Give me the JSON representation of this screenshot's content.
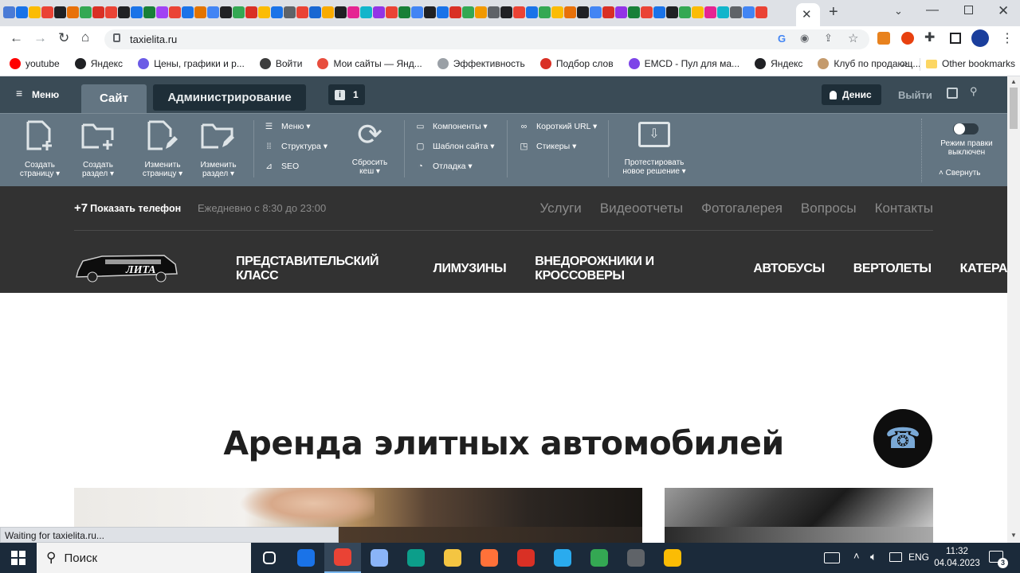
{
  "browser": {
    "url": "taxielita.ru",
    "tab_colors": [
      "#4a7bd6",
      "#1a73e8",
      "#fbbc04",
      "#ea4335",
      "#202124",
      "#e8710a",
      "#34a853",
      "#d93025",
      "#ea4335",
      "#202124",
      "#1a73e8",
      "#188038",
      "#a142f4",
      "#ea4335",
      "#1a73e8",
      "#e37400",
      "#4285f4",
      "#202124",
      "#34a853",
      "#d93025",
      "#fbbc04",
      "#1a73e8",
      "#5f6368",
      "#ea4335",
      "#1967d2",
      "#f9ab00",
      "#202124",
      "#e52592",
      "#12b5cb",
      "#9334e6",
      "#ea4335",
      "#188038",
      "#4285f4",
      "#202124",
      "#1a73e8",
      "#d93025",
      "#34a853",
      "#f29900",
      "#5f6368",
      "#202124",
      "#ea4335",
      "#1a73e8",
      "#34a853",
      "#fbbc04",
      "#e8710a",
      "#202124",
      "#4285f4",
      "#d93025",
      "#9334e6",
      "#188038",
      "#ea4335",
      "#1a73e8",
      "#202124",
      "#34a853",
      "#fbbc04",
      "#e52592",
      "#12b5cb",
      "#5f6368",
      "#4285f4",
      "#ea4335"
    ],
    "bookmarks": [
      {
        "label": "youtube",
        "color": "#ff0000"
      },
      {
        "label": "Яндекс",
        "color": "#202124"
      },
      {
        "label": "Цены, графики и р...",
        "color": "#6b5be6"
      },
      {
        "label": "Войти",
        "color": "#3c3c3c"
      },
      {
        "label": "Мои сайты — Янд...",
        "color": "#e84d3d"
      },
      {
        "label": "Эффективность",
        "color": "#9aa0a6"
      },
      {
        "label": "Подбор слов",
        "color": "#d93025"
      },
      {
        "label": "EMCD - Пул для ма...",
        "color": "#7d45e8"
      },
      {
        "label": "Яндекс",
        "color": "#202124"
      },
      {
        "label": "Клуб по продающ...",
        "color": "#c49a6c"
      }
    ],
    "more_bookmarks": "»",
    "other_bookmarks": "Other bookmarks",
    "status": "Waiting for taxielita.ru..."
  },
  "admin": {
    "menu": "Меню",
    "tab_site": "Сайт",
    "tab_admin": "Администрирование",
    "notifications": "1",
    "user": "Денис",
    "logout": "Выйти",
    "buttons": [
      {
        "icon": "create-page-icon",
        "l1": "Создать",
        "l2": "страницу ▾"
      },
      {
        "icon": "create-section-icon",
        "l1": "Создать",
        "l2": "раздел ▾"
      },
      {
        "icon": "edit-page-icon",
        "l1": "Изменить",
        "l2": "страницу ▾"
      },
      {
        "icon": "edit-section-icon",
        "l1": "Изменить",
        "l2": "раздел ▾"
      }
    ],
    "links1": [
      "Меню ▾",
      "Структура ▾",
      "SEO"
    ],
    "cache_l1": "Сбросить",
    "cache_l2": "кеш ▾",
    "links2": [
      "Компоненты ▾",
      "Шаблон сайта ▾",
      "Отладка ▾"
    ],
    "links3": [
      "Короткий URL ▾",
      "Стикеры ▾"
    ],
    "test_l1": "Протестировать",
    "test_l2": "новое решение ▾",
    "edit_mode_l1": "Режим правки",
    "edit_mode_l2": "выключен",
    "collapse": "Свернуть"
  },
  "site": {
    "phone_prefix": "+7",
    "phone_show": "Показать телефон",
    "hours": "Ежедневно с 8:30 до 23:00",
    "top_nav": [
      "Услуги",
      "Видеоотчеты",
      "Фотогалерея",
      "Вопросы",
      "Контакты"
    ],
    "logo_text": "ЛИТА",
    "main_nav": [
      "ПРЕДСТАВИТЕЛЬСКИЙ КЛАСС",
      "ЛИМУЗИНЫ",
      "ВНЕДОРОЖНИКИ И КРОССОВЕРЫ",
      "АВТОБУСЫ",
      "ВЕРТОЛЕТЫ",
      "КАТЕРА"
    ],
    "heading": "Аренда элитных автомобилей"
  },
  "taskbar": {
    "search": "Поиск",
    "lang": "ENG",
    "time": "11:32",
    "date": "04.04.2023",
    "notif_count": "3"
  }
}
